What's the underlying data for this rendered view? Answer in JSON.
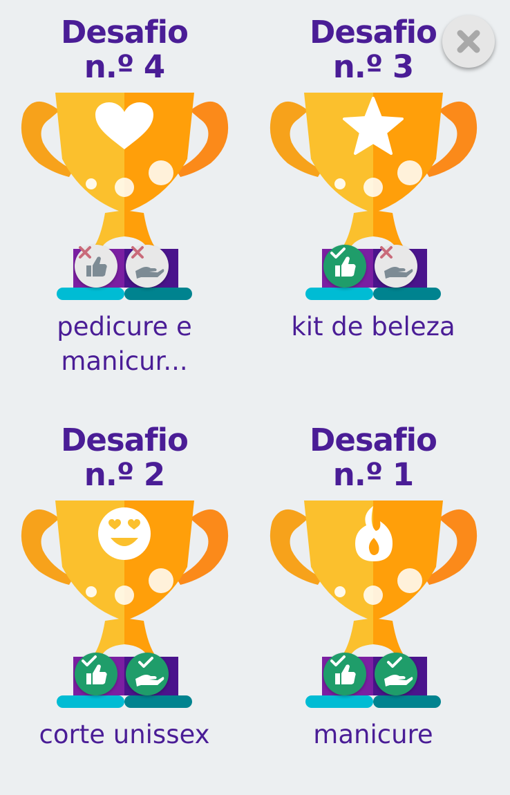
{
  "challenges": [
    {
      "title_line1": "Desafio",
      "title_line2": "n.º 4",
      "icon": "heart-icon",
      "prize_line1": "pedicure e",
      "prize_line2": "manicur...",
      "action1_done": false,
      "action2_done": false
    },
    {
      "title_line1": "Desafio",
      "title_line2": "n.º 3",
      "icon": "star-icon",
      "prize_line1": "kit de beleza",
      "prize_line2": "",
      "action1_done": true,
      "action2_done": false
    },
    {
      "title_line1": "Desafio",
      "title_line2": "n.º 2",
      "icon": "heart-eyes-emoji-icon",
      "prize_line1": "corte unissex",
      "prize_line2": "",
      "action1_done": true,
      "action2_done": true
    },
    {
      "title_line1": "Desafio",
      "title_line2": "n.º 1",
      "icon": "flame-icon",
      "prize_line1": "manicure",
      "prize_line2": "",
      "action1_done": true,
      "action2_done": true
    }
  ],
  "close_icon": "close-icon",
  "colors": {
    "title": "#4a1d96",
    "done": "#1f9d6a",
    "pending": "#e8e8e8",
    "cross": "#c96b7a"
  }
}
